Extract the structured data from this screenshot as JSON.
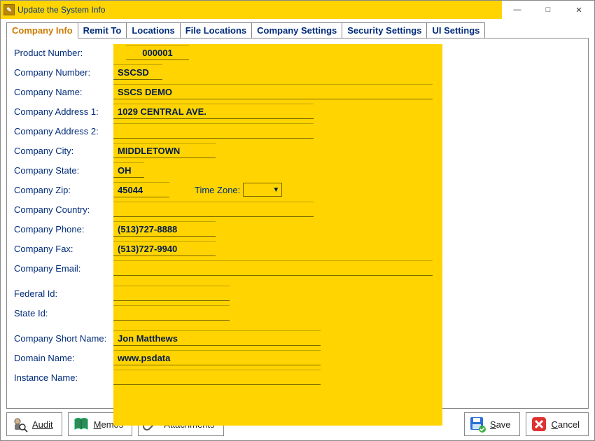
{
  "title": "Update the System Info",
  "tabs": [
    "Company Info",
    "Remit To",
    "Locations",
    "File Locations",
    "Company Settings",
    "Security Settings",
    "UI Settings"
  ],
  "labels": {
    "product_number": "Product Number:",
    "company_number": "Company Number:",
    "company_name": "Company Name:",
    "addr1": "Company Address 1:",
    "addr2": "Company Address 2:",
    "city": "Company City:",
    "state": "Company State:",
    "zip": "Company Zip:",
    "timezone": "Time Zone:",
    "country": "Company Country:",
    "phone": "Company Phone:",
    "fax": "Company Fax:",
    "email": "Company Email:",
    "fed_id": "Federal Id:",
    "state_id": "State Id:",
    "short_name": "Company Short Name:",
    "domain": "Domain Name:",
    "instance": "Instance Name:"
  },
  "vals": {
    "product_number": "000001",
    "company_number": "SSCSD",
    "company_name": "SSCS DEMO",
    "addr1": "1029 CENTRAL AVE.",
    "addr2": "",
    "city": "MIDDLETOWN",
    "state": "OH",
    "zip": "45044",
    "timezone": "",
    "country": "",
    "phone": "(513)727-8888",
    "fax": "(513)727-9940",
    "email": "",
    "fed_id": "",
    "state_id": "",
    "short_name": "Jon Matthews",
    "domain": "www.psdata",
    "instance": ""
  },
  "footer": {
    "audit": "Audit",
    "memos": "Memos",
    "attachments": "Attachments",
    "save": "Save",
    "cancel": "Cancel"
  }
}
